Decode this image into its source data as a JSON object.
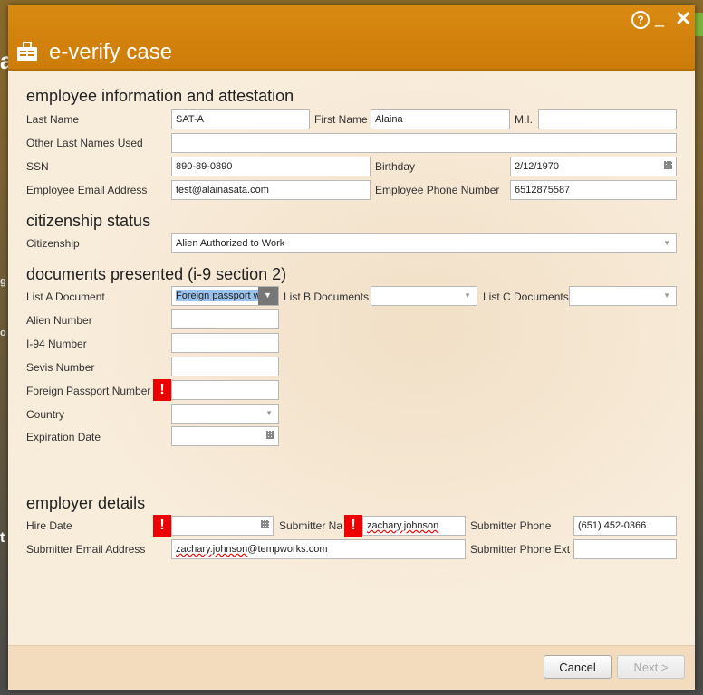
{
  "dialog": {
    "title": "e-verify case",
    "help_label": "?",
    "minimize_label": "_",
    "close_label": "✕"
  },
  "background": {
    "fragment_a": "a",
    "fragment_g": "g",
    "fragment_o": "o",
    "fragment_t": "t"
  },
  "employee": {
    "section_title": "employee information and attestation",
    "last_name_label": "Last Name",
    "last_name_value": "SAT-A",
    "first_name_label": "First Name",
    "first_name_value": "Alaina",
    "mi_label": "M.I.",
    "mi_value": "",
    "other_last_names_label": "Other Last Names Used",
    "other_last_names_value": "",
    "ssn_label": "SSN",
    "ssn_value": "890-89-0890",
    "birthday_label": "Birthday",
    "birthday_value": "2/12/1970",
    "email_label": "Employee Email Address",
    "email_value": "test@alainasata.com",
    "phone_label": "Employee Phone Number",
    "phone_value": "6512875587"
  },
  "citizenship": {
    "section_title": "citizenship status",
    "label": "Citizenship",
    "value": "Alien Authorized to Work"
  },
  "documents": {
    "section_title": "documents presented (i-9 section 2)",
    "list_a_label": "List A Document",
    "list_a_value": "Foreign passport w",
    "list_b_label": "List B Documents",
    "list_b_value": "",
    "list_c_label": "List C Documents",
    "list_c_value": "",
    "alien_number_label": "Alien Number",
    "i94_label": "I-94 Number",
    "sevis_label": "Sevis Number",
    "foreign_passport_label": "Foreign Passport Number",
    "country_label": "Country",
    "expiration_label": "Expiration Date",
    "required_mark": "!"
  },
  "employer": {
    "section_title": "employer details",
    "hire_date_label": "Hire Date",
    "hire_date_value": "",
    "submitter_name_label": "Submitter Na",
    "submitter_name_value": "zachary.johnson",
    "submitter_phone_label": "Submitter Phone",
    "submitter_phone_value": "(651) 452-0366",
    "submitter_email_label": "Submitter Email Address",
    "submitter_email_user": "zachary.johnson",
    "submitter_email_domain": "@tempworks.com",
    "submitter_phone_ext_label": "Submitter Phone Ext",
    "submitter_phone_ext_value": ""
  },
  "footer": {
    "cancel_label": "Cancel",
    "next_label": "Next >"
  }
}
